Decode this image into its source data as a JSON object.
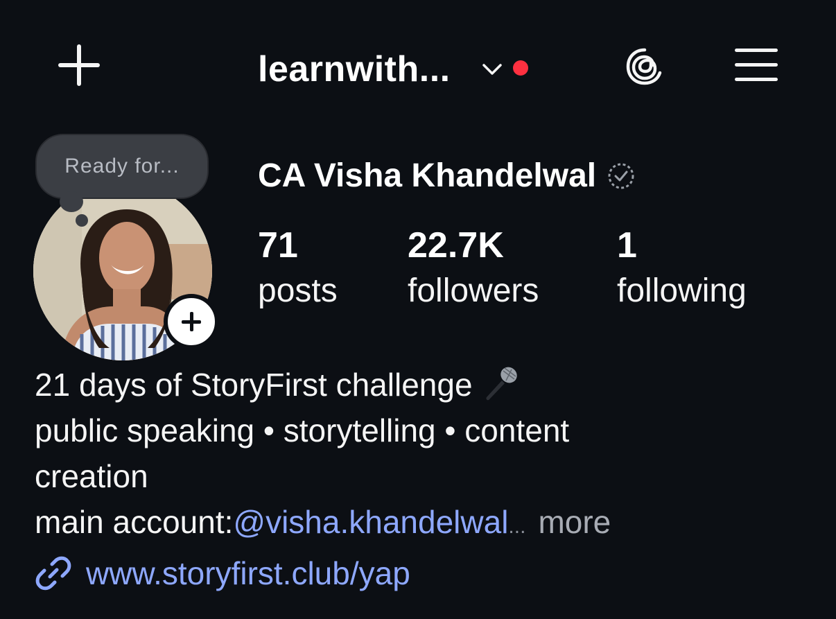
{
  "header": {
    "username": "learnwith...",
    "notification_color": "#ff3040",
    "icons": [
      "plus-icon",
      "chevron-down-icon",
      "threads-icon",
      "hamburger-menu-icon"
    ]
  },
  "profile": {
    "note": "Ready for...",
    "display_name": "CA Visha Khandelwal",
    "stats": {
      "posts_count": "71",
      "posts_label": "posts",
      "followers_count": "22.7K",
      "followers_label": "followers",
      "following_count": "1",
      "following_label": "following"
    }
  },
  "bio": {
    "line1": "21 days of StoryFirst challenge",
    "line2": "public speaking • storytelling • content",
    "line3": "creation",
    "line4_prefix": "main account:",
    "mention": "@visha.khandelwal",
    "ellipsis": "...",
    "more_label": "more",
    "link": "www.storyfirst.club/yap"
  },
  "colors": {
    "background": "#0c0f14",
    "link": "#8ea8ff",
    "muted": "#a8acb4"
  }
}
